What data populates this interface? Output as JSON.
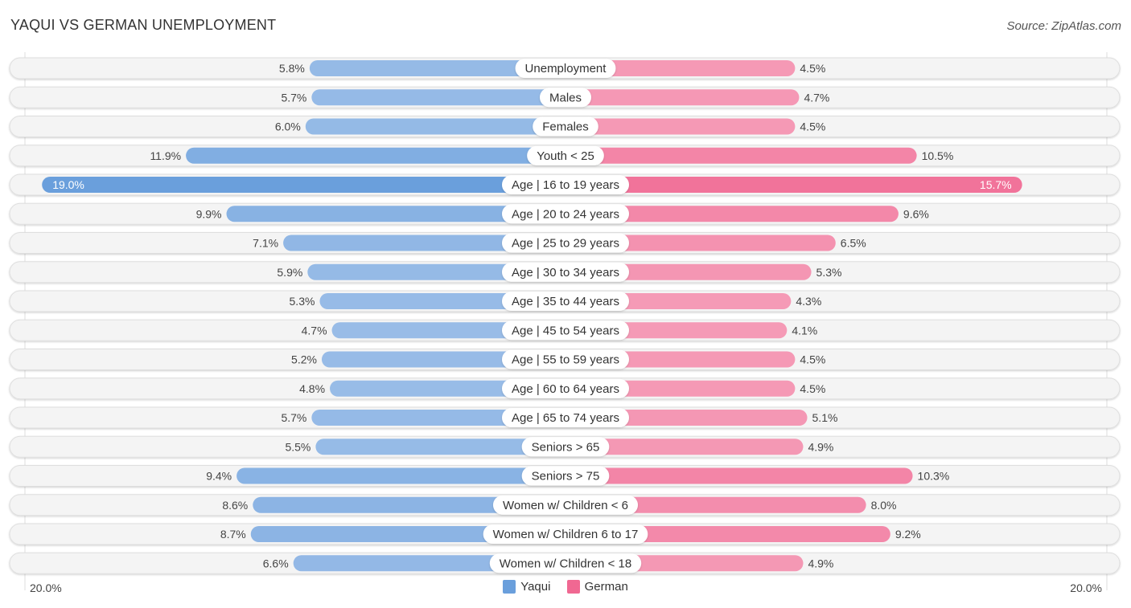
{
  "header": {
    "title": "YAQUI VS GERMAN UNEMPLOYMENT",
    "source": "Source: ZipAtlas.com"
  },
  "colors": {
    "yaqui": "#6a9fdc",
    "yaqui_light": "#a8c6eb",
    "german": "#f06892",
    "german_light": "#f6a8c0"
  },
  "chart_data": {
    "type": "bar",
    "orientation": "horizontal-diverging",
    "title": "YAQUI VS GERMAN UNEMPLOYMENT",
    "xlim": [
      -20,
      20
    ],
    "axis_min_label": "20.0%",
    "axis_max_label": "20.0%",
    "legend": [
      "Yaqui",
      "German"
    ],
    "legend_position": "bottom-center",
    "categories": [
      "Unemployment",
      "Males",
      "Females",
      "Youth < 25",
      "Age | 16 to 19 years",
      "Age | 20 to 24 years",
      "Age | 25 to 29 years",
      "Age | 30 to 34 years",
      "Age | 35 to 44 years",
      "Age | 45 to 54 years",
      "Age | 55 to 59 years",
      "Age | 60 to 64 years",
      "Age | 65 to 74 years",
      "Seniors > 65",
      "Seniors > 75",
      "Women w/ Children < 6",
      "Women w/ Children 6 to 17",
      "Women w/ Children < 18"
    ],
    "series": [
      {
        "name": "Yaqui",
        "values": [
          5.8,
          5.7,
          6.0,
          11.9,
          19.0,
          9.9,
          7.1,
          5.9,
          5.3,
          4.7,
          5.2,
          4.8,
          5.7,
          5.5,
          9.4,
          8.6,
          8.7,
          6.6
        ],
        "labels": [
          "5.8%",
          "5.7%",
          "6.0%",
          "11.9%",
          "19.0%",
          "9.9%",
          "7.1%",
          "5.9%",
          "5.3%",
          "4.7%",
          "5.2%",
          "4.8%",
          "5.7%",
          "5.5%",
          "9.4%",
          "8.6%",
          "8.7%",
          "6.6%"
        ]
      },
      {
        "name": "German",
        "values": [
          4.5,
          4.7,
          4.5,
          10.5,
          15.7,
          9.6,
          6.5,
          5.3,
          4.3,
          4.1,
          4.5,
          4.5,
          5.1,
          4.9,
          10.3,
          8.0,
          9.2,
          4.9
        ],
        "labels": [
          "4.5%",
          "4.7%",
          "4.5%",
          "10.5%",
          "15.7%",
          "9.6%",
          "6.5%",
          "5.3%",
          "4.3%",
          "4.1%",
          "4.5%",
          "4.5%",
          "5.1%",
          "4.9%",
          "10.3%",
          "8.0%",
          "9.2%",
          "4.9%"
        ]
      }
    ]
  }
}
